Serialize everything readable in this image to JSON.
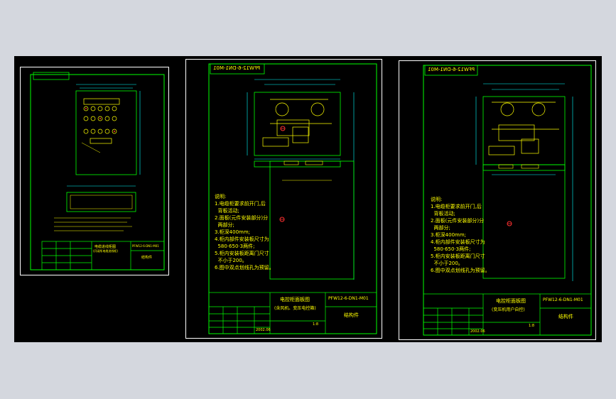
{
  "colors": {
    "background": "#d4d7de",
    "model_space": "#000000",
    "border": "#ffffff",
    "frame": "#00ff00",
    "drawing": "#ffff00",
    "dimension": "#00ffff",
    "notes": "#ffff00",
    "marker": "#ff3030"
  },
  "sheet_left": {
    "title_block": {
      "name": "电缆进线柜图",
      "subname": "(开闭所电缆进线柜)",
      "drawing_no": "PFW12-6-DN1-M01",
      "part": "结构件"
    }
  },
  "sheet_center": {
    "tag": "PFW12-6-DN1-M01",
    "notes": {
      "title": "说明:",
      "items": [
        "1.电缆柜要求前开门,后",
        "  背板活动;",
        "2.面板(元件安装部分)分",
        "  两部分;",
        "3.柜深400mm;",
        "4.柜内部件安装板尺寸为",
        "  580·650·3两件;",
        "5.柜内安装板距离门尺寸",
        "  不小于200。",
        "6.图中双点划线孔为预留。"
      ]
    },
    "title_block": {
      "name": "电控柜面板图",
      "subname": "(含风机、变压电控箱)",
      "drawing_no": "PFW12-6-DN1-M01",
      "part": "结构件",
      "scale": "1:8",
      "date": "2002.06"
    }
  },
  "sheet_right": {
    "tag": "PFW12-6-DN1-M01",
    "notes": {
      "title": "说明:",
      "items": [
        "1.电缆柜要求前开门,后",
        "  背板活动;",
        "2.面板(元件安装部分)分",
        "  两部分;",
        "3.柜深400mm;",
        "4.柜内部件安装板尺寸为",
        "  580·650·3两件;",
        "5.柜内安装板距离门尺寸",
        "  不小于200。",
        "6.图中双点划线孔为预留。"
      ]
    },
    "title_block": {
      "name": "电控柜面板图",
      "subname": "(变压机用户自控)",
      "drawing_no": "PFW12-6-DN1-M01",
      "part": "结构件",
      "scale": "1:8",
      "date": "2002.06"
    }
  }
}
